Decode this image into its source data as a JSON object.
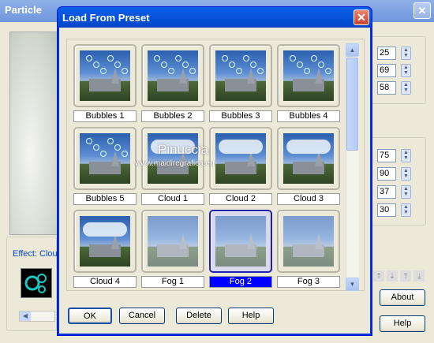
{
  "background_window": {
    "title": "Particle",
    "close_glyph": "✕",
    "spin_values_top": [
      "25",
      "69",
      "58"
    ],
    "spin_values_bottom": [
      "75",
      "90",
      "37",
      "30"
    ],
    "effect_label": "Effect: Clouds",
    "about_label": "About",
    "help_label": "Help"
  },
  "dialog": {
    "title": "Load From Preset",
    "close_glyph": "✕",
    "presets": [
      {
        "label": "Bubbles 1",
        "selected": false
      },
      {
        "label": "Bubbles 2",
        "selected": false
      },
      {
        "label": "Bubbles 3",
        "selected": false
      },
      {
        "label": "Bubbles 4",
        "selected": false
      },
      {
        "label": "Bubbles 5",
        "selected": false
      },
      {
        "label": "Cloud 1",
        "selected": false
      },
      {
        "label": "Cloud 2",
        "selected": false
      },
      {
        "label": "Cloud 3",
        "selected": false
      },
      {
        "label": "Cloud 4",
        "selected": false
      },
      {
        "label": "Fog 1",
        "selected": false
      },
      {
        "label": "Fog 2",
        "selected": true
      },
      {
        "label": "Fog 3",
        "selected": false
      }
    ],
    "buttons": {
      "ok": "OK",
      "cancel": "Cancel",
      "delete": "Delete",
      "help": "Help"
    }
  },
  "watermark": {
    "line1": "Pinuccia",
    "line2": "www.maidiregrafica.eu"
  }
}
